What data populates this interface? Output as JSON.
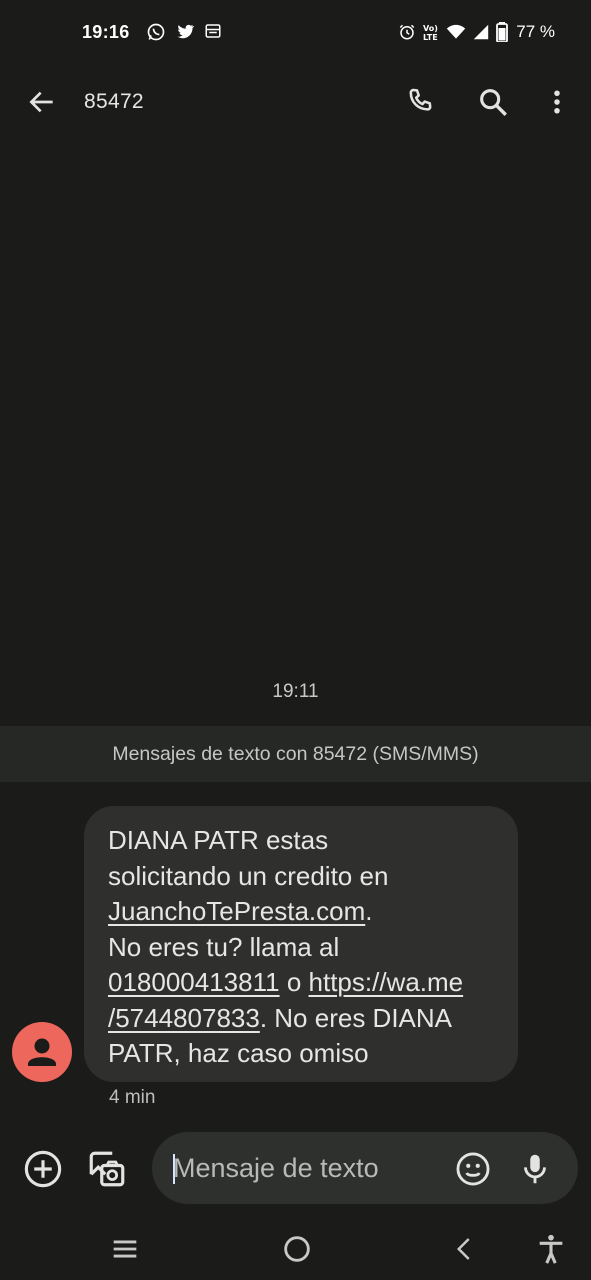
{
  "status_bar": {
    "time": "19:16",
    "battery": "77 %",
    "left_icons": [
      "whatsapp-icon",
      "twitter-icon",
      "calendar-icon"
    ],
    "right_icons": [
      "alarm-icon",
      "volte-icon",
      "wifi-icon",
      "signal-icon",
      "battery-icon"
    ]
  },
  "header": {
    "title": "85472",
    "icons": [
      "back-arrow-icon",
      "phone-icon",
      "search-icon",
      "more-vert-icon"
    ]
  },
  "conversation": {
    "timestamp": "19:11",
    "info_strip": "Mensajes de texto con 85472 (SMS/MMS)",
    "message": {
      "parts": [
        "DIANA PATR estas",
        "solicitando un credito en",
        "JuanchoTePresta.com",
        ".",
        "No eres tu? llama al",
        "018000413811",
        " o ",
        "https://wa.me",
        "/5744807833",
        ". No eres DIANA",
        "PATR, haz caso omiso"
      ],
      "age": "4 min"
    }
  },
  "compose": {
    "placeholder": "Mensaje de texto",
    "icons": [
      "add-circle-icon",
      "gallery-icon",
      "emoji-icon",
      "mic-icon"
    ]
  },
  "nav": {
    "icons": [
      "recents-icon",
      "home-icon",
      "back-icon",
      "accessibility-icon"
    ]
  },
  "colors": {
    "background": "#1b1c1a",
    "bubble": "#2f302e",
    "avatar": "#ee675c",
    "info_strip": "#262826",
    "compose_field": "#2e302d"
  }
}
